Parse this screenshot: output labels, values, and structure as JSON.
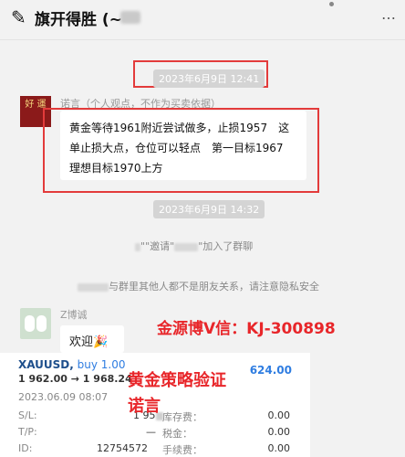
{
  "header": {
    "logo_glyph": "✎",
    "title": "旗开得胜 (~",
    "more_glyph": "…"
  },
  "timestamps": [
    "2023年6月9日 12:41",
    "2023年6月9日 14:32"
  ],
  "message1": {
    "avatar_text": "好 運",
    "sender": "诺言（个人观点，不作为买卖依据）",
    "text": "黄金等待1961附近尝试做多，止损1957　这单止损大点，仓位可以轻点　第一目标1967　理想目标1970上方"
  },
  "system_messages": {
    "join": [
      "\"",
      "\"邀请\"",
      "\"加入了群聊"
    ],
    "privacy": [
      "与群里其他人都不是朋友关系，请注意隐私安全"
    ]
  },
  "message2": {
    "sender": "Z博诚",
    "text": "欢迎",
    "emoji": "🎉"
  },
  "overlay": {
    "contact": "金源博V信：KJ-300898",
    "strategy_line1": "黄金策略验证",
    "strategy_line2": "诺言"
  },
  "trade_card": {
    "symbol": "XAUUSD,",
    "side": "buy 1.00",
    "prices": "1 962.00 → 1 968.24",
    "profit": "624.00",
    "datetime": "2023.06.09 08:07",
    "sl_label": "S/L:",
    "sl_value": "1 95",
    "tp_label": "T/P:",
    "tp_value": "—",
    "id_label": "ID:",
    "id_value": "12754572",
    "storage_label": "库存费：",
    "storage_value": "0.00",
    "tax_label": "税金：",
    "tax_value": "0.00",
    "commission_label": "手续费：",
    "commission_value": "0.00"
  },
  "colors": {
    "annotation_red": "#e33b3b",
    "buy_blue": "#2f7de1"
  }
}
